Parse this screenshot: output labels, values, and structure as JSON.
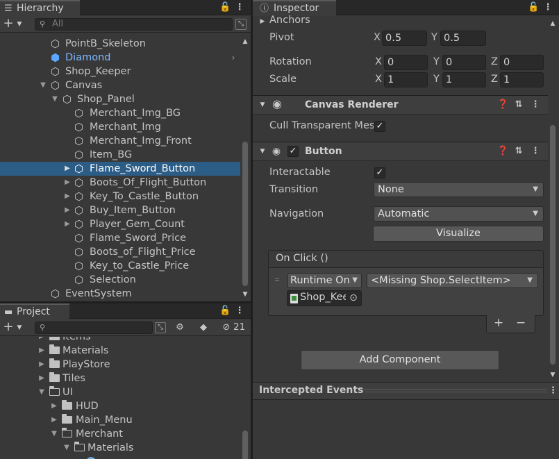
{
  "hierarchy": {
    "tab_label": "Hierarchy",
    "search_placeholder": "All",
    "rows": [
      {
        "label": "PointB_Skeleton"
      },
      {
        "label": "Diamond"
      },
      {
        "label": "Shop_Keeper"
      },
      {
        "label": "Canvas"
      },
      {
        "label": "Shop_Panel"
      },
      {
        "label": "Merchant_Img_BG"
      },
      {
        "label": "Merchant_Img"
      },
      {
        "label": "Merchant_Img_Front"
      },
      {
        "label": "Item_BG"
      },
      {
        "label": "Flame_Sword_Button"
      },
      {
        "label": "Boots_Of_Flight_Button"
      },
      {
        "label": "Key_To_Castle_Button"
      },
      {
        "label": "Buy_Item_Button"
      },
      {
        "label": "Player_Gem_Count"
      },
      {
        "label": "Flame_Sword_Price"
      },
      {
        "label": "Boots_of_Flight_Price"
      },
      {
        "label": "Key_to_Castle_Price"
      },
      {
        "label": "Selection"
      },
      {
        "label": "EventSystem"
      }
    ]
  },
  "project": {
    "tab_label": "Project",
    "hidden_count": "21",
    "rows": [
      {
        "label": "Items"
      },
      {
        "label": "Materials"
      },
      {
        "label": "PlayStore"
      },
      {
        "label": "Tiles"
      },
      {
        "label": "UI"
      },
      {
        "label": "HUD"
      },
      {
        "label": "Main_Menu"
      },
      {
        "label": "Merchant"
      },
      {
        "label": "Materials"
      }
    ]
  },
  "inspector": {
    "tab_label": "Inspector",
    "anchors_label": "Anchors",
    "pivot": {
      "label": "Pivot",
      "x_axis": "X",
      "y_axis": "Y",
      "x": "0.5",
      "y": "0.5"
    },
    "rotation": {
      "label": "Rotation",
      "x_axis": "X",
      "y_axis": "Y",
      "z_axis": "Z",
      "x": "0",
      "y": "0",
      "z": "0"
    },
    "scale": {
      "label": "Scale",
      "x_axis": "X",
      "y_axis": "Y",
      "z_axis": "Z",
      "x": "1",
      "y": "1",
      "z": "1"
    },
    "canvas_renderer": {
      "title": "Canvas Renderer",
      "cull_label": "Cull Transparent Mes"
    },
    "button_component": {
      "title": "Button",
      "interactable_label": "Interactable",
      "transition_label": "Transition",
      "transition_value": "None",
      "navigation_label": "Navigation",
      "navigation_value": "Automatic",
      "visualize_label": "Visualize",
      "onclick_title": "On Click ()",
      "runtime_value": "Runtime On",
      "function_value": "<Missing Shop.SelectItem>",
      "object_value": "Shop_Kee",
      "add_label": "+",
      "remove_label": "−"
    },
    "add_component_label": "Add Component",
    "intercepted_events_label": "Intercepted Events"
  }
}
